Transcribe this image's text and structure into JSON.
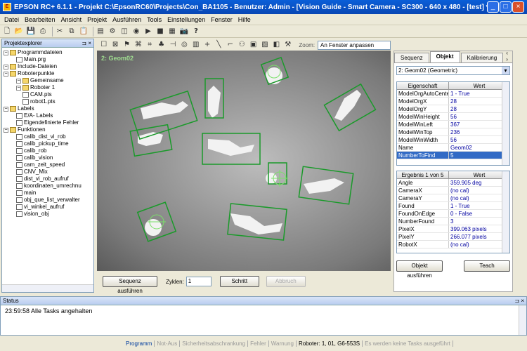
{
  "window": {
    "title": "EPSON RC+ 6.1.1  - Projekt C:\\EpsonRC60\\Projects\\Con_BA1105 - Benutzer: Admin - [Vision Guide - Smart Camera - SC300 - 640 x 480 - [test] *]"
  },
  "menu": [
    "Datei",
    "Bearbeiten",
    "Ansicht",
    "Projekt",
    "Ausführen",
    "Tools",
    "Einstellungen",
    "Fenster",
    "Hilfe"
  ],
  "explorer": {
    "title": "Projektexplorer",
    "items": [
      "Programmdateien",
      "Main.prg",
      "Include-Dateien",
      "Roboterpunkte",
      "Gemeinsame",
      "Roboter 1",
      "CAM.pts",
      "robot1.pts",
      "Labels",
      "E/A- Labels",
      "Eigendefinierte Fehler",
      "Funktionen",
      "calib_dist_vi_rob",
      "calib_pickup_time",
      "calib_rob",
      "calib_vision",
      "cam_zeit_speed",
      "CNV_Mix",
      "dist_vi_rob_aufruf",
      "koordinaten_umrechnu",
      "main",
      "obj_que_list_verwalter",
      "vi_winkel_aufruf",
      "vision_obj"
    ]
  },
  "vision": {
    "zoom_label": "Zoom:",
    "zoom_value": "An Fenster anpassen",
    "overlay_label": "2: Geom02",
    "sequence_button": "Sequenz ausführen",
    "cycles_label": "Zyklen:",
    "cycles_value": "1",
    "step_button": "Schritt",
    "abort_button": "Abbruch"
  },
  "right": {
    "tabs": [
      "Sequenz",
      "Objekt",
      "Kalibrierung"
    ],
    "object_select": "2: Geom02 (Geometric)",
    "prop_header": [
      "Eigenschaft",
      "Wert"
    ],
    "props": [
      [
        "ModelOrgAutoCenter",
        "1 - True"
      ],
      [
        "ModelOrgX",
        "28"
      ],
      [
        "ModelOrgY",
        "28"
      ],
      [
        "ModelWinHeight",
        "56"
      ],
      [
        "ModelWinLeft",
        "367"
      ],
      [
        "ModelWinTop",
        "236"
      ],
      [
        "ModelWinWidth",
        "56"
      ],
      [
        "Name",
        "Geom02"
      ],
      [
        "NumberToFind",
        "5"
      ]
    ],
    "result_header": [
      "Ergebnis 1 von 5",
      "Wert"
    ],
    "results": [
      [
        "Angle",
        "359.905 deg"
      ],
      [
        "CameraX",
        "(no cal)"
      ],
      [
        "CameraY",
        "(no cal)"
      ],
      [
        "Found",
        "1 - True"
      ],
      [
        "FoundOnEdge",
        "0 - False"
      ],
      [
        "NumberFound",
        "3"
      ],
      [
        "PixelX",
        "399.063 pixels"
      ],
      [
        "PixelY",
        "266.077 pixels"
      ],
      [
        "RobotX",
        "(no cal)"
      ]
    ],
    "run_object_button": "Objekt ausführen",
    "teach_button": "Teach"
  },
  "status": {
    "title": "Status",
    "message": "23:59:58 Alle Tasks angehalten"
  },
  "statusbar": {
    "items": [
      "Programm",
      "Not-Aus",
      "Sicherheitsabschrankung",
      "Fehler",
      "Warnung"
    ],
    "robot": "Roboter: 1, 01, G6-553S",
    "tasks": "Es werden keine Tasks ausgeführt"
  }
}
